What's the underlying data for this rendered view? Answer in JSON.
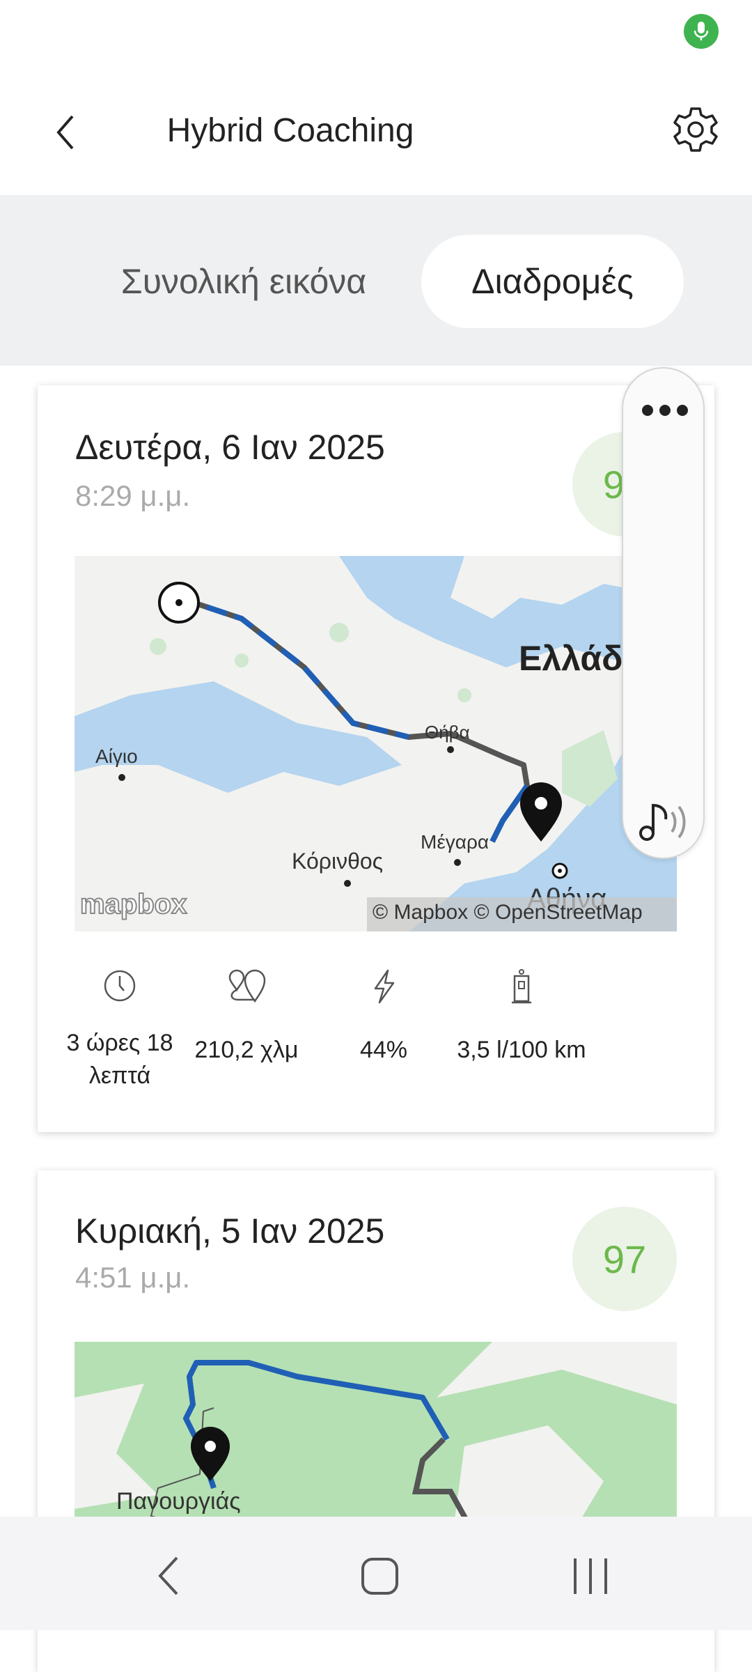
{
  "header": {
    "title": "Hybrid Coaching",
    "back_icon": "chevron-left-icon",
    "settings_icon": "gear-icon"
  },
  "tabs": [
    {
      "label": "Συνολική εικόνα",
      "selected": false
    },
    {
      "label": "Διαδρομές",
      "selected": true
    }
  ],
  "trips": [
    {
      "date": "Δευτέρα, 6 Ιαν 2025",
      "time": "8:29 μ.μ.",
      "score": "97",
      "map": {
        "labels": {
          "country": "Ελλάδα",
          "thiva": "Θήβα",
          "aigio": "Αίγιο",
          "korinthos": "Κόρινθος",
          "megara": "Μέγαρα",
          "athina": "Αθήνα"
        },
        "logo": "mapbox",
        "attribution": "© Mapbox © OpenStreetMap"
      },
      "stats": {
        "duration": "3 ώρες 18 λεπτά",
        "distance": "210,2 χλμ",
        "ev_ratio": "44%",
        "consumption": "3,5 l/100 km"
      }
    },
    {
      "date": "Κυριακή, 5 Ιαν 2025",
      "time": "4:51 μ.μ.",
      "score": "97",
      "map": {
        "labels": {
          "place": "Πανουργιάς"
        }
      }
    }
  ],
  "colors": {
    "accent_green": "#6cb84c",
    "route_blue": "#1f5fb5",
    "route_gray": "#555555"
  }
}
